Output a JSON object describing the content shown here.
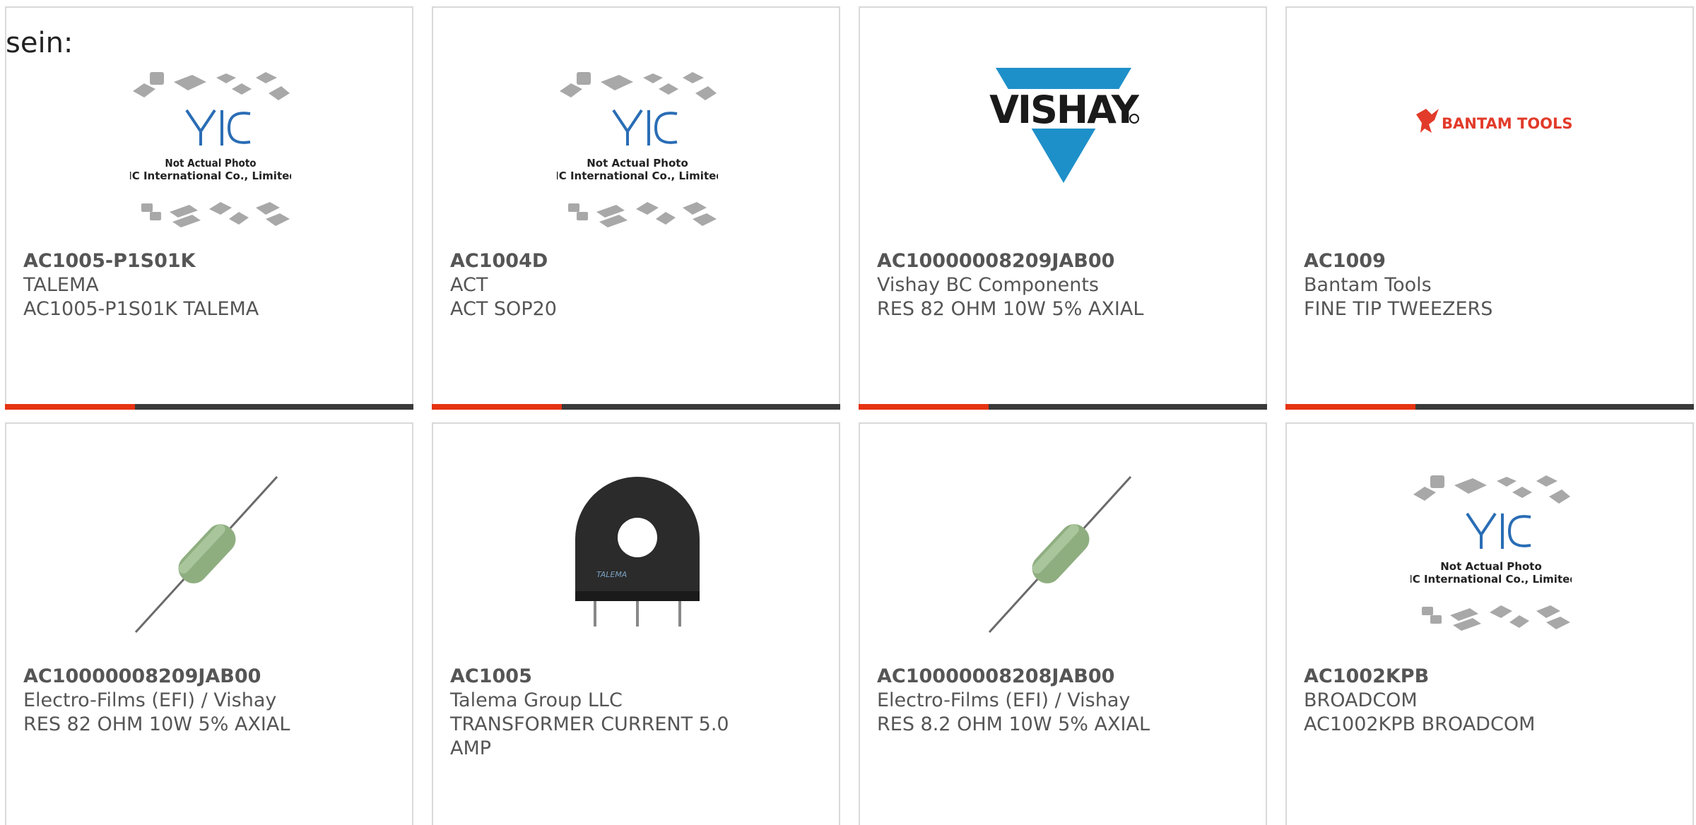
{
  "heading": "sein:",
  "colors": {
    "accent": "#e63312",
    "bar": "#3a3a3a",
    "text": "#555555"
  },
  "products": [
    {
      "part": "AC1005-P1S01K",
      "maker": "TALEMA",
      "desc": "AC1005-P1S01K TALEMA",
      "image": "yic-placeholder",
      "image_text": [
        "Not Actual Photo",
        "YIC International Co., Limited."
      ]
    },
    {
      "part": "AC1004D",
      "maker": "ACT",
      "desc": "ACT SOP20",
      "image": "yic-placeholder",
      "image_text": [
        "Not Actual Photo",
        "YIC International Co., Limited."
      ]
    },
    {
      "part": "AC10000008209JAB00",
      "maker": "Vishay BC Components",
      "desc": "RES 82 OHM 10W 5% AXIAL",
      "image": "vishay-logo",
      "image_text": [
        "VISHAY"
      ]
    },
    {
      "part": "AC1009",
      "maker": "Bantam Tools",
      "desc": "FINE TIP TWEEZERS",
      "image": "bantam-logo",
      "image_text": [
        "BANTAM TOOLS"
      ]
    },
    {
      "part": "AC10000008209JAB00",
      "maker": "Electro-Films (EFI) / Vishay",
      "desc": "RES 82 OHM 10W 5% AXIAL",
      "image": "resistor-photo"
    },
    {
      "part": "AC1005",
      "maker": "Talema Group LLC",
      "desc": "TRANSFORMER CURRENT 5.0 AMP",
      "image": "transformer-photo",
      "image_text": [
        "TALEMA"
      ]
    },
    {
      "part": "AC10000008208JAB00",
      "maker": "Electro-Films (EFI) / Vishay",
      "desc": "RES 8.2 OHM 10W 5% AXIAL",
      "image": "resistor-photo"
    },
    {
      "part": "AC1002KPB",
      "maker": "BROADCOM",
      "desc": "AC1002KPB BROADCOM",
      "image": "yic-placeholder",
      "image_text": [
        "Not Actual Photo",
        "YIC International Co., Limited."
      ]
    }
  ]
}
